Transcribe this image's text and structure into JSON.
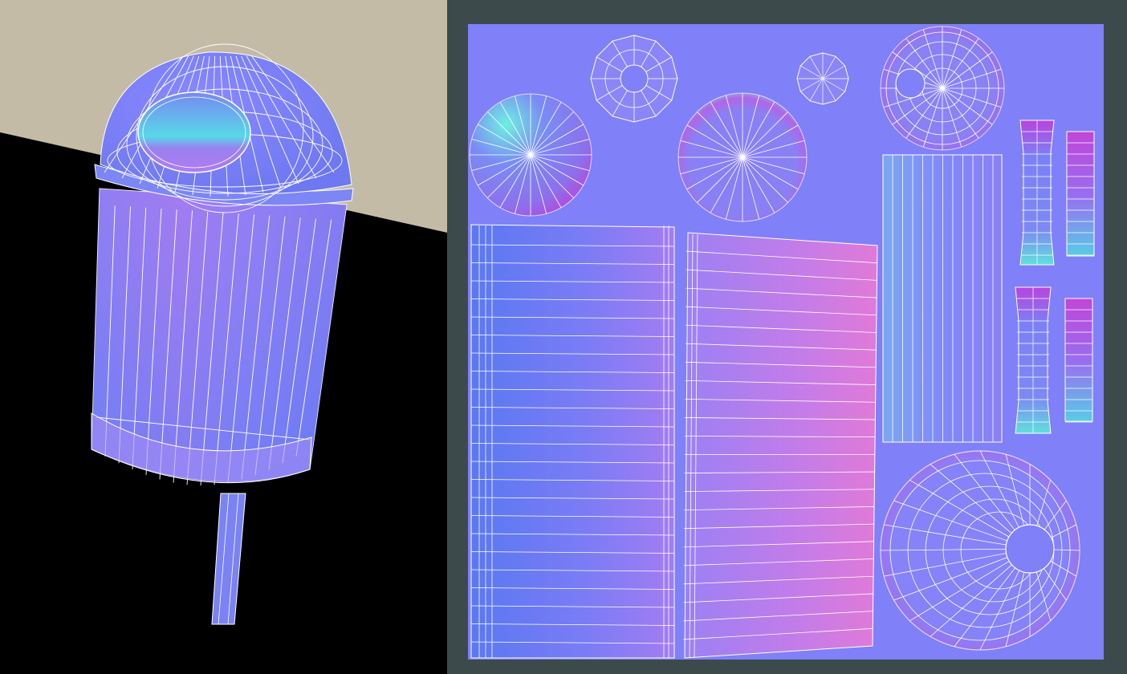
{
  "viewport": {
    "model": "trash-bin",
    "colors": {
      "floor": "#000000",
      "wall": "#c4bba6",
      "wire": "#ffffff"
    }
  },
  "uv_editor": {
    "colors": {
      "frame": "#3c4a4b",
      "sheet": "#8080f8",
      "flat_normal": "#8080ff",
      "tint_cyan": "#5ce0d6",
      "tint_magenta": "#e05cd0",
      "tint_blue": "#5a78f0",
      "wire": "#ffffff"
    },
    "islands": [
      "bin-body-left",
      "bin-body-right",
      "lid-dome-top",
      "lid-dome-bottom",
      "small-disc",
      "medium-disc",
      "ring-disc",
      "tiny-disc",
      "narrow-strip",
      "stem-upper",
      "stem-lower"
    ]
  }
}
